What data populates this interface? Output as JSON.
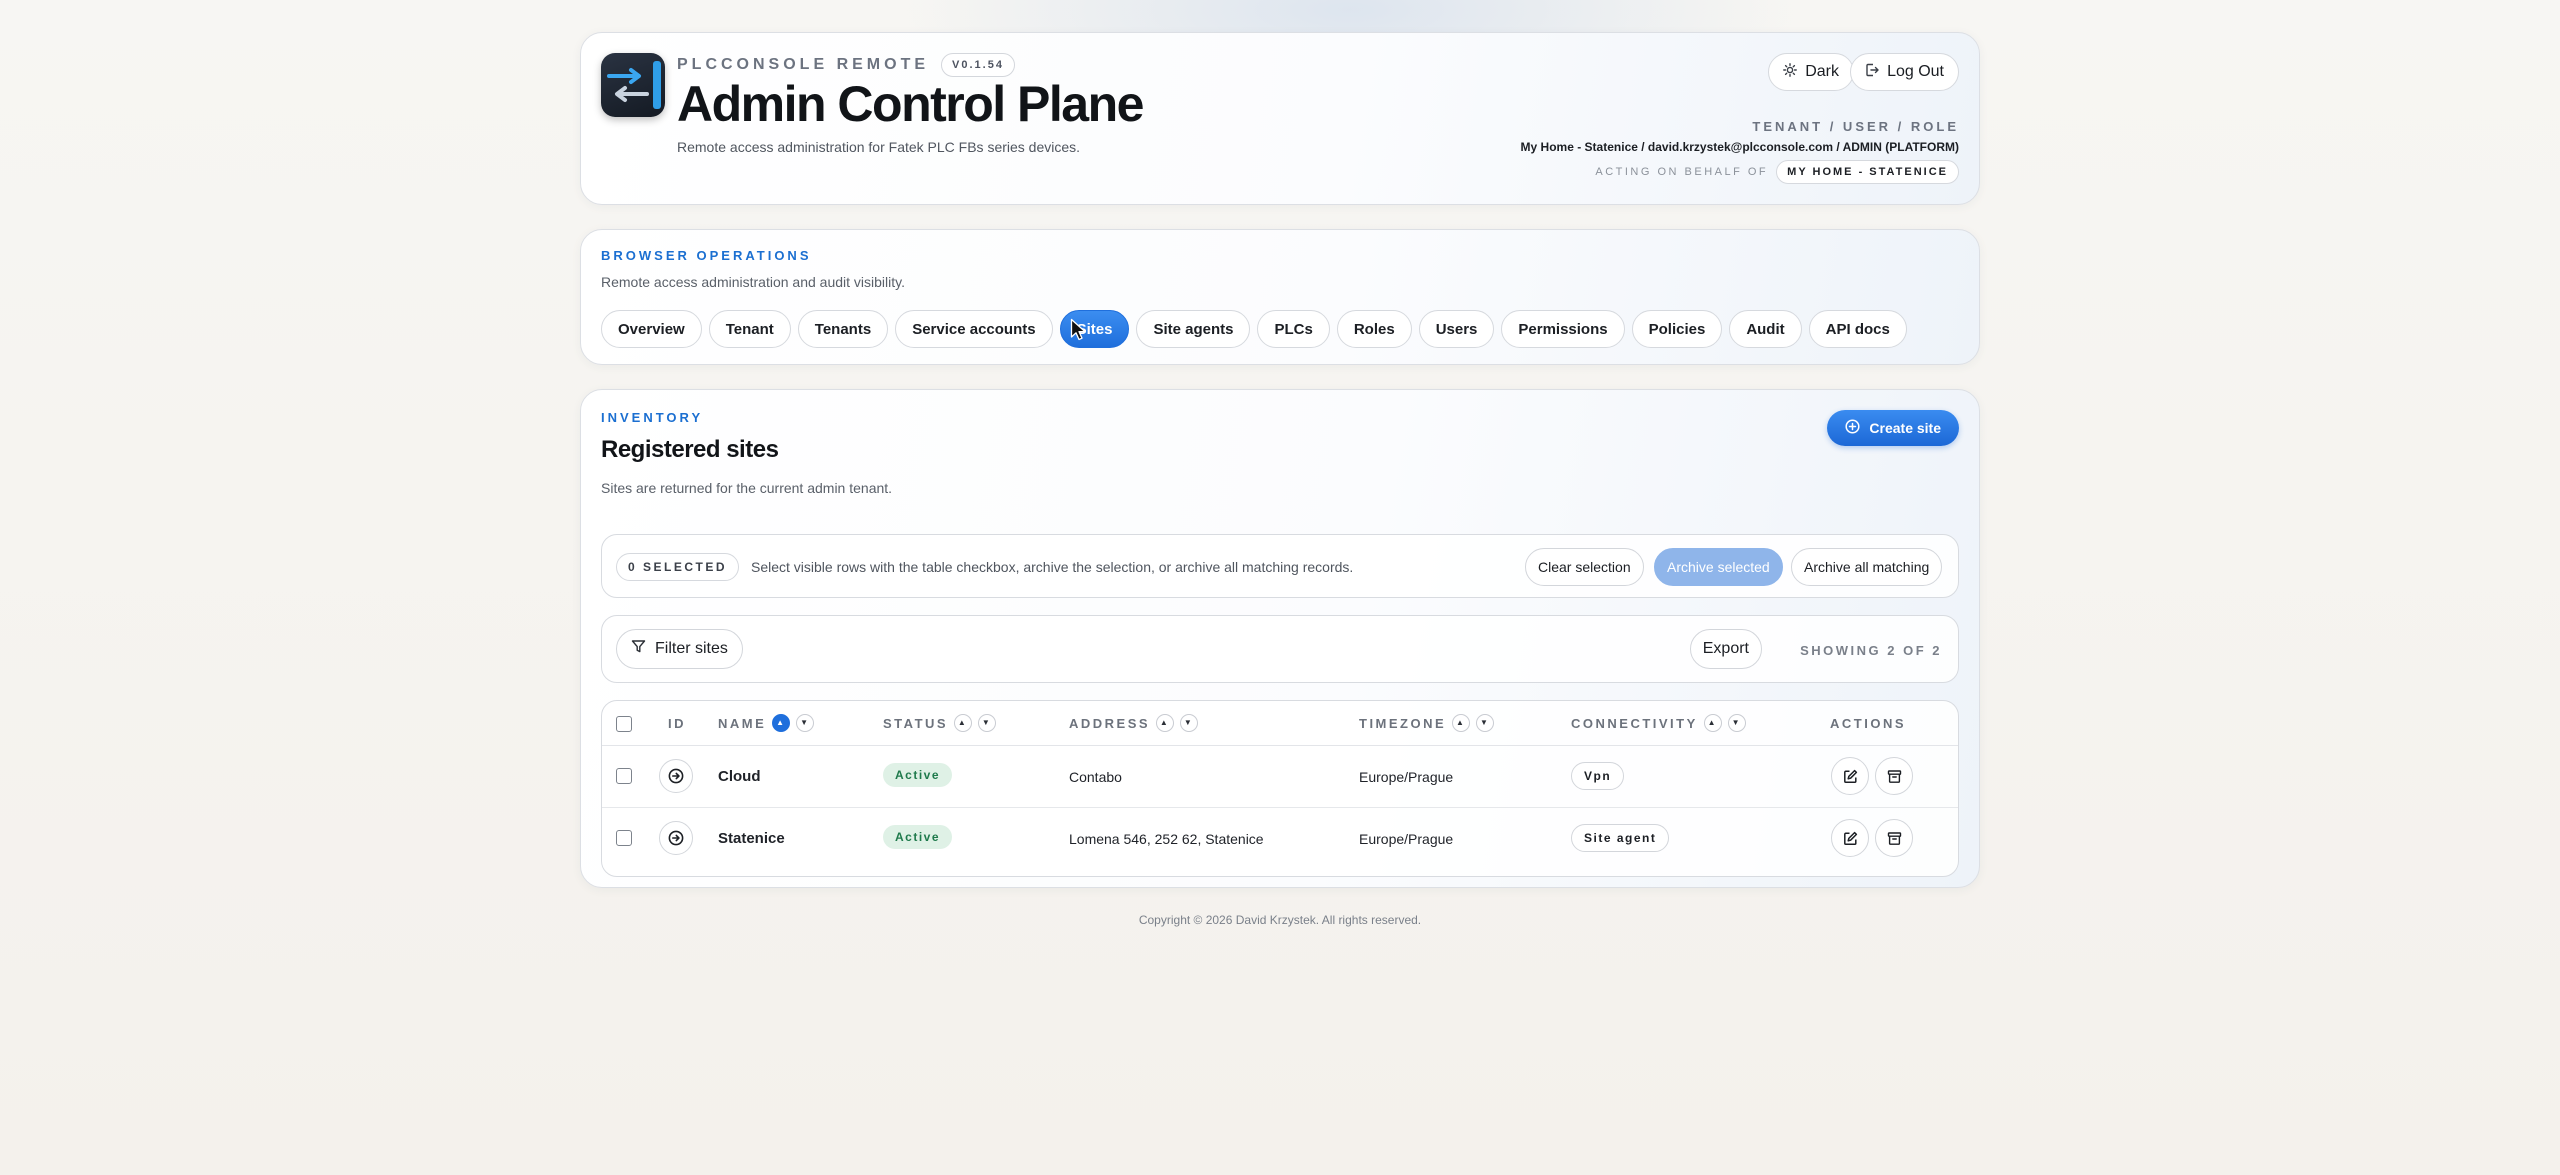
{
  "header": {
    "brand": "PLCCONSOLE REMOTE",
    "version": "V0.1.54",
    "title": "Admin Control Plane",
    "subtitle": "Remote access administration for Fatek PLC FBs series devices.",
    "dark_label": "Dark",
    "logout_label": "Log Out",
    "role_label": "TENANT / USER / ROLE",
    "role_value": "My Home - Statenice / david.krzystek@plcconsole.com / ADMIN (PLATFORM)",
    "behalf_label": "ACTING ON BEHALF OF",
    "behalf_value": "MY HOME - STATENICE"
  },
  "ops": {
    "eyebrow": "BROWSER OPERATIONS",
    "description": "Remote access administration and audit visibility.",
    "tabs": [
      {
        "label": "Overview"
      },
      {
        "label": "Tenant"
      },
      {
        "label": "Tenants"
      },
      {
        "label": "Service accounts"
      },
      {
        "label": "Sites",
        "active": true
      },
      {
        "label": "Site agents"
      },
      {
        "label": "PLCs"
      },
      {
        "label": "Roles"
      },
      {
        "label": "Users"
      },
      {
        "label": "Permissions"
      },
      {
        "label": "Policies"
      },
      {
        "label": "Audit"
      },
      {
        "label": "API docs"
      }
    ]
  },
  "inventory": {
    "eyebrow": "INVENTORY",
    "title": "Registered sites",
    "description": "Sites are returned for the current admin tenant.",
    "create_label": "Create site",
    "selection": {
      "count_label": "0 SELECTED",
      "hint": "Select visible rows with the table checkbox, archive the selection, or archive all matching records.",
      "clear_label": "Clear selection",
      "archive_selected_label": "Archive selected",
      "archive_all_label": "Archive all matching"
    },
    "filter_label": "Filter sites",
    "export_label": "Export",
    "showing": "SHOWING 2 OF 2",
    "columns": {
      "id": "ID",
      "name": "NAME",
      "status": "STATUS",
      "address": "ADDRESS",
      "timezone": "TIMEZONE",
      "connectivity": "CONNECTIVITY",
      "actions": "ACTIONS"
    },
    "rows": [
      {
        "name": "Cloud",
        "status": "Active",
        "address": "Contabo",
        "timezone": "Europe/Prague",
        "connectivity": "Vpn"
      },
      {
        "name": "Statenice",
        "status": "Active",
        "address": "Lomena 546, 252 62, Statenice",
        "timezone": "Europe/Prague",
        "connectivity": "Site agent"
      }
    ]
  },
  "footer": "Copyright © 2026 David Krzystek. All rights reserved.",
  "colors": {
    "accent": "#1f6fdc",
    "status_active_bg": "#dff1e6",
    "status_active_text": "#1f7a4c"
  }
}
